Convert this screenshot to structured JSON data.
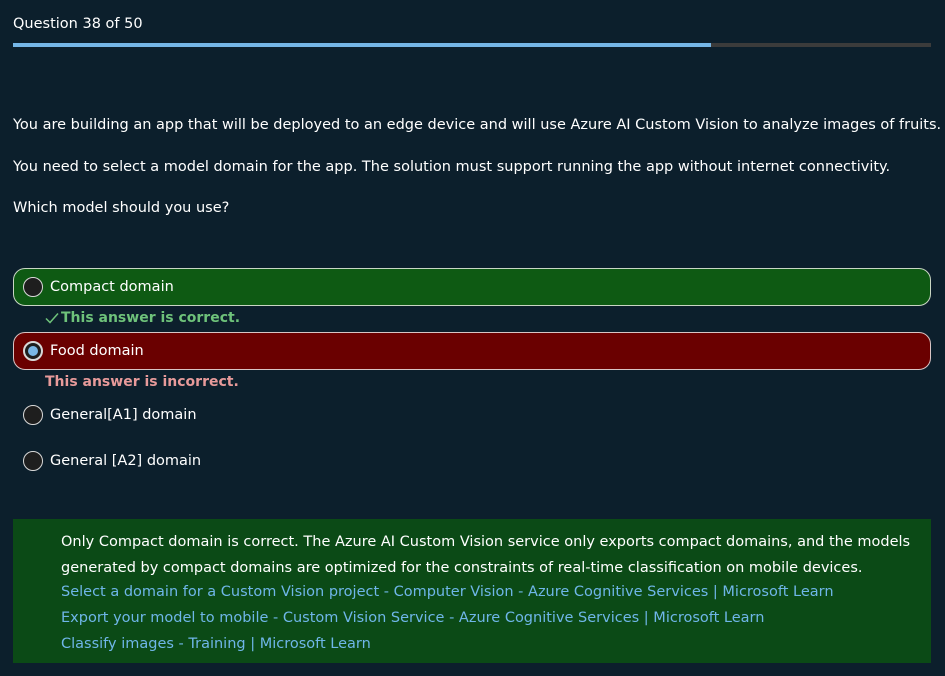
{
  "progress": {
    "label": "Question 38 of 50",
    "current": 38,
    "total": 50,
    "fraction": 0.76
  },
  "question": {
    "paragraphs": [
      "You are building an app that will be deployed to an edge device and will use Azure AI Custom Vision to analyze images of fruits.",
      "You need to select a model domain for the app. The solution must support running the app without internet connectivity.",
      "Which model should you use?"
    ]
  },
  "options": [
    {
      "label": "Compact domain",
      "state": "correct",
      "selected": false
    },
    {
      "label": "Food domain",
      "state": "incorrect",
      "selected": true
    },
    {
      "label": "General[A1] domain",
      "state": "none",
      "selected": false
    },
    {
      "label": "General [A2] domain",
      "state": "none",
      "selected": false
    }
  ],
  "feedback": {
    "correct": "This answer is correct.",
    "incorrect": "This answer is incorrect."
  },
  "explanation": {
    "text": "Only Compact domain is correct. The Azure AI Custom Vision service only exports compact domains, and the models generated by compact domains are optimized for the constraints of real-time classification on mobile devices.",
    "links": [
      "Select a domain for a Custom Vision project - Computer Vision - Azure Cognitive Services | Microsoft Learn",
      "Export your model to mobile - Custom Vision Service - Azure Cognitive Services | Microsoft Learn",
      "Classify images - Training | Microsoft Learn"
    ]
  },
  "colors": {
    "background": "#0c1f2c",
    "progress_fill": "#75b6e7",
    "correct_bg": "#0e5a13",
    "incorrect_bg": "#6a0000",
    "explanation_bg": "#0b4a16",
    "link": "#6fb6e8"
  },
  "icons": {
    "check": "check-icon",
    "radio": "radio-icon"
  }
}
